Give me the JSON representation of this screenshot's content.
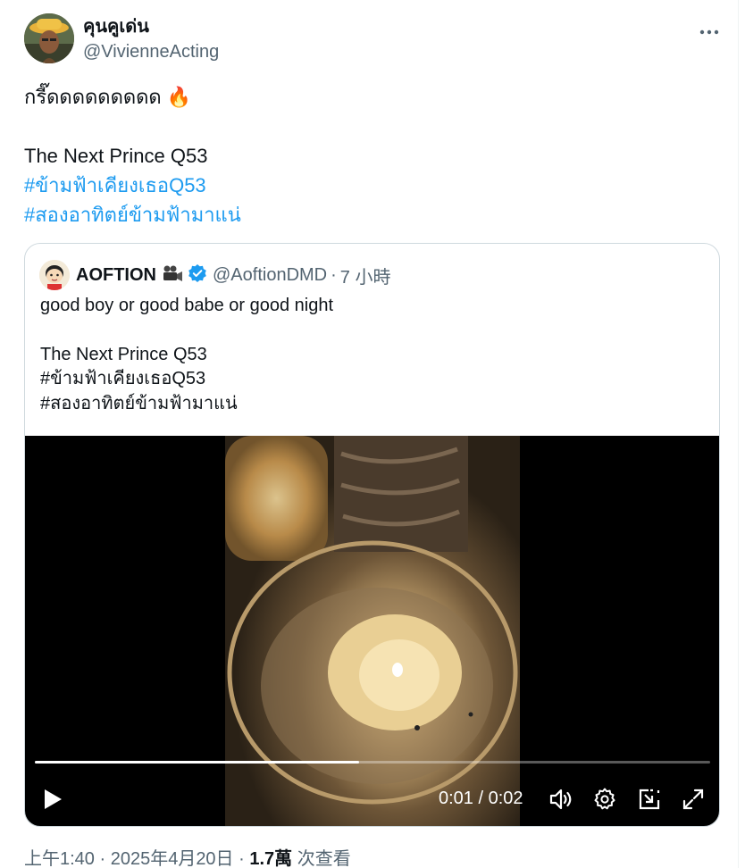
{
  "author": {
    "display_name": "คุนคูเด่น",
    "handle": "@VivienneActing"
  },
  "tweet": {
    "line1": "กรี๊ดดดดดดดดด",
    "emoji": "🔥",
    "line2": "The Next Prince Q53",
    "hashtag1": "#ข้ามฟ้าเคียงเธอQ53",
    "hashtag2": "#สองอาทิตย์ข้ามฟ้ามาแน่"
  },
  "quoted": {
    "display_name": "AOFTION",
    "handle": "@AoftionDMD",
    "separator": "·",
    "time": "7 小時",
    "line1": "good boy or good babe or good night",
    "line2": "The Next Prince Q53",
    "line3": "#ข้ามฟ้าเคียงเธอQ53",
    "line4": "#สองอาทิตย์ข้ามฟ้ามาแน่"
  },
  "video": {
    "time_display": "0:01 / 0:02",
    "progress": 0.48
  },
  "footer": {
    "timestamp": "上午1:40 · 2025年4月20日 · ",
    "views_count": "1.7萬",
    "views_label": " 次查看"
  },
  "icons": {
    "more": "more-horizontal-icon",
    "verified": "verified-badge-icon",
    "camera": "movie-camera-icon",
    "play": "play-icon",
    "volume": "volume-icon",
    "settings": "gear-icon",
    "pip": "picture-in-picture-icon",
    "fullscreen": "fullscreen-icon"
  },
  "colors": {
    "link": "#1d9bf0",
    "secondary_text": "#536471",
    "border": "#cfd9de"
  }
}
